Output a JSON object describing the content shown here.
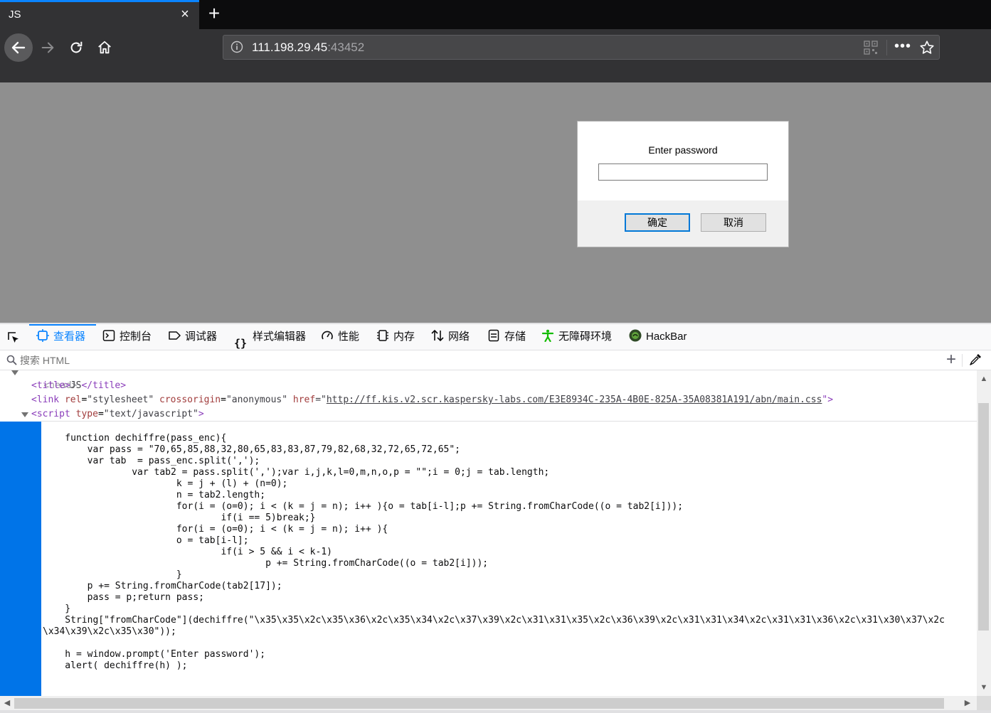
{
  "tab": {
    "title": "JS",
    "close": "×",
    "new_tab": "+"
  },
  "urlbar": {
    "host": "111.198.29.45",
    "port": ":43452",
    "more": "•••"
  },
  "dialog": {
    "message": "Enter password",
    "input_value": "",
    "ok_label": "确定",
    "cancel_label": "取消"
  },
  "devtools": {
    "tabs": [
      {
        "label": "查看器",
        "icon": "inspector-icon",
        "active": true
      },
      {
        "label": "控制台",
        "icon": "console-icon"
      },
      {
        "label": "调试器",
        "icon": "debugger-icon"
      },
      {
        "label": "样式编辑器",
        "icon": "style-editor-icon"
      },
      {
        "label": "性能",
        "icon": "performance-icon"
      },
      {
        "label": "内存",
        "icon": "memory-icon"
      },
      {
        "label": "网络",
        "icon": "network-icon"
      },
      {
        "label": "存储",
        "icon": "storage-icon"
      },
      {
        "label": "无障碍环境",
        "icon": "accessibility-icon"
      },
      {
        "label": "HackBar",
        "icon": "hackbar-icon"
      }
    ],
    "search_placeholder": "搜索 HTML",
    "add_node": "+"
  },
  "markup": {
    "head_tag": "<head>",
    "title_open": "<title>",
    "title_text": "JS",
    "title_close": "</title>",
    "link_open": "<link",
    "link_rel_name": "rel",
    "link_rel_val": "\"stylesheet\"",
    "link_cross_name": "crossorigin",
    "link_cross_val": "\"anonymous\"",
    "link_href_name": "href",
    "link_href_quote_open": "=\"",
    "link_href_val": "http://ff.kis.v2.scr.kaspersky-labs.com/E3E8934C-235A-4B0E-825A-35A08381A191/abn/main.css",
    "link_close": "\">",
    "script_open": "<script",
    "script_type_name": "type",
    "script_type_val": "\"text/javascript\"",
    "script_gt": ">",
    "code": "\n    function dechiffre(pass_enc){\n        var pass = \"70,65,85,88,32,80,65,83,83,87,79,82,68,32,72,65,72,65\";\n        var tab  = pass_enc.split(',');\n                var tab2 = pass.split(',');var i,j,k,l=0,m,n,o,p = \"\";i = 0;j = tab.length;\n                        k = j + (l) + (n=0);\n                        n = tab2.length;\n                        for(i = (o=0); i < (k = j = n); i++ ){o = tab[i-l];p += String.fromCharCode((o = tab2[i]));\n                                if(i == 5)break;}\n                        for(i = (o=0); i < (k = j = n); i++ ){\n                        o = tab[i-l];\n                                if(i > 5 && i < k-1)\n                                        p += String.fromCharCode((o = tab2[i]));\n                        }\n        p += String.fromCharCode(tab2[17]);\n        pass = p;return pass;\n    }\n    String[\"fromCharCode\"](dechiffre(\"\\x35\\x35\\x2c\\x35\\x36\\x2c\\x35\\x34\\x2c\\x37\\x39\\x2c\\x31\\x31\\x35\\x2c\\x36\\x39\\x2c\\x31\\x31\\x34\\x2c\\x31\\x31\\x36\\x2c\\x31\\x30\\x37\\x2c\n\\x34\\x39\\x2c\\x35\\x30\"));\n\n    h = window.prompt('Enter password');\n    alert( dechiffre(h) );"
  },
  "colors": {
    "accent": "#0a84ff",
    "selection": "#0074e8",
    "overlay": "#8f8f8f",
    "chrome_dark": "#323234"
  }
}
